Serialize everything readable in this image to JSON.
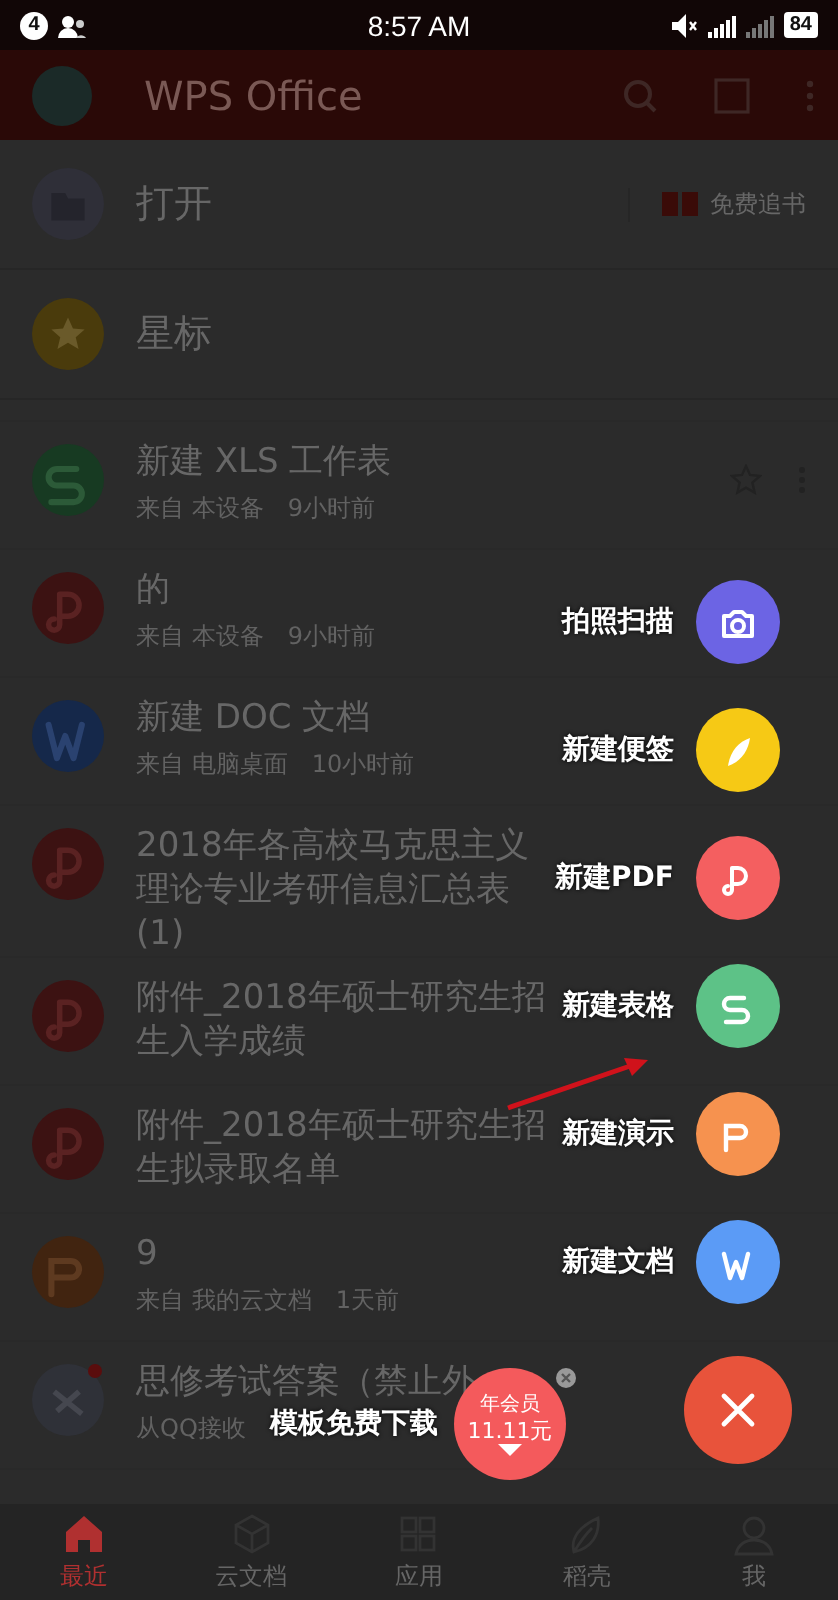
{
  "status_bar": {
    "notification_count": "4",
    "time": "8:57 AM",
    "battery": "84"
  },
  "app_bar": {
    "title": "WPS Office"
  },
  "quick_items": [
    {
      "kind": "folder",
      "label": "打开",
      "promo": "免费追书"
    },
    {
      "kind": "star",
      "label": "星标"
    }
  ],
  "files": [
    {
      "kind": "sheet",
      "title": "新建 XLS 工作表",
      "source": "来自 本设备",
      "time": "9小时前",
      "starrable": true
    },
    {
      "kind": "pdf",
      "title": "的",
      "source": "来自 本设备",
      "time": "9小时前"
    },
    {
      "kind": "doc",
      "title": "新建 DOC 文档",
      "source": "来自 电脑桌面",
      "time": "10小时前"
    },
    {
      "kind": "pdf",
      "title": "2018年各高校马克思主义理论专业考研信息汇总表(1)"
    },
    {
      "kind": "pdf",
      "title": "附件_2018年硕士研究生招生入学成绩"
    },
    {
      "kind": "pdf",
      "title": "附件_2018年硕士研究生招生拟录取名单"
    },
    {
      "kind": "slides",
      "title": "9",
      "source": "来自 我的云文档",
      "time": "1天前"
    },
    {
      "kind": "qq",
      "title": "思修考试答案（禁止外",
      "source": "从QQ接收",
      "unread": true
    }
  ],
  "create_menu": [
    {
      "kind": "camera",
      "label": "拍照扫描",
      "color": "#6c64e4"
    },
    {
      "kind": "note",
      "label": "新建便签",
      "color": "#f6c915"
    },
    {
      "kind": "pdf",
      "label": "新建PDF",
      "color": "#f45f60"
    },
    {
      "kind": "sheet",
      "label": "新建表格",
      "color": "#5dc287"
    },
    {
      "kind": "slides",
      "label": "新建演示",
      "color": "#f6924f"
    },
    {
      "kind": "doc",
      "label": "新建文档",
      "color": "#5b9bf6"
    }
  ],
  "promo": {
    "label": "模板免费下载",
    "badge_line1": "年会员",
    "badge_line2": "11.11元"
  },
  "tabs": [
    {
      "kind": "home",
      "label": "最近",
      "selected": true
    },
    {
      "kind": "cloud",
      "label": "云文档",
      "selected": false
    },
    {
      "kind": "apps",
      "label": "应用",
      "selected": false
    },
    {
      "kind": "leaf",
      "label": "稻壳",
      "selected": false
    },
    {
      "kind": "person",
      "label": "我",
      "selected": false
    }
  ]
}
